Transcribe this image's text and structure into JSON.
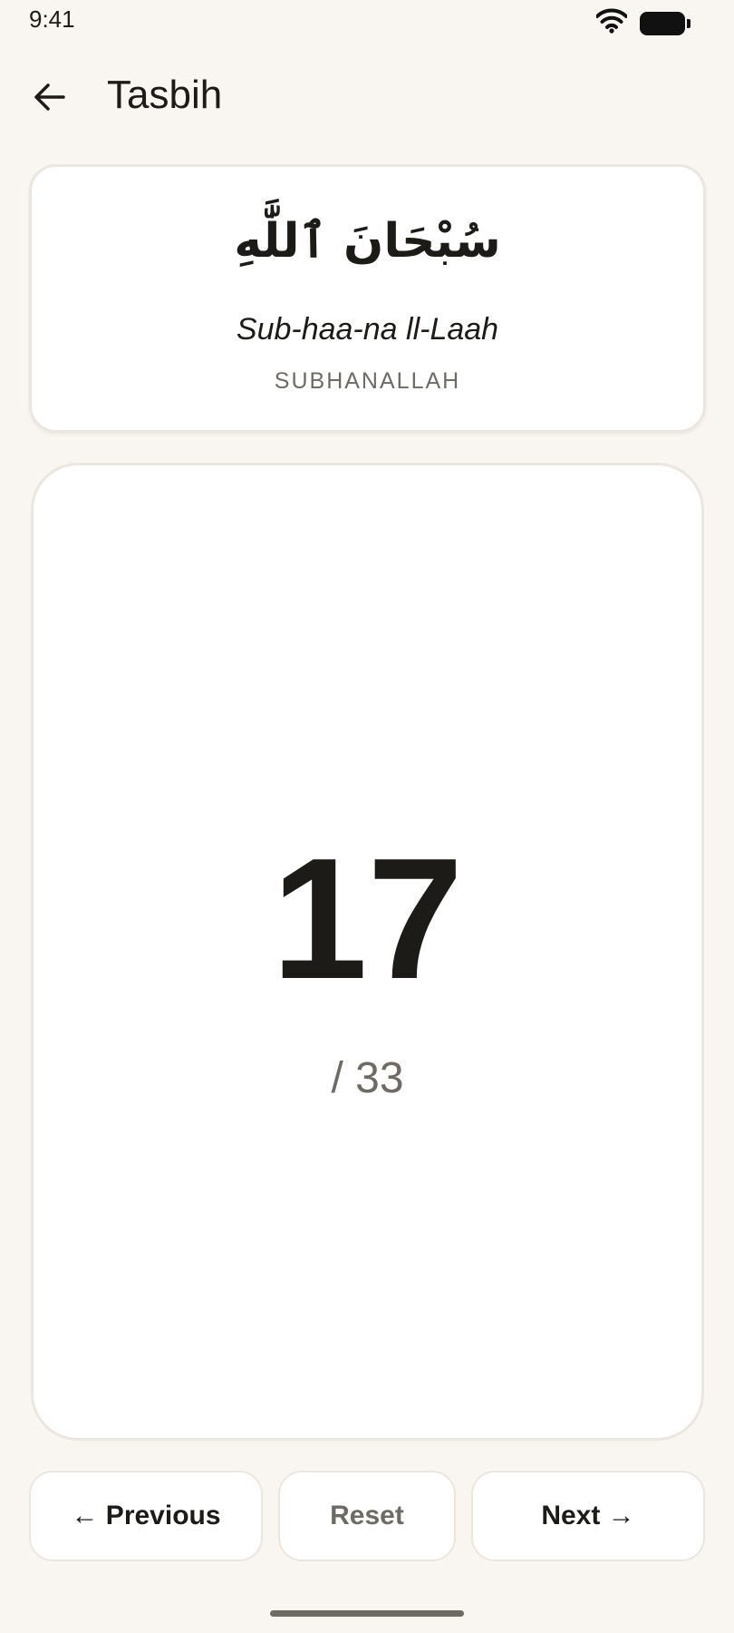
{
  "status_bar": {
    "time": "9:41",
    "icons": [
      "wifi-icon",
      "battery-icon"
    ]
  },
  "app_bar": {
    "back_icon": "arrow-left-icon",
    "title": "Tasbih"
  },
  "dhikr": {
    "arabic": "سُبْحَانَ ٱللَّٰهِ",
    "transliteration": "Sub-haa-na ll-Laah",
    "name": "SUBHANALLAH"
  },
  "counter": {
    "count": "17",
    "target": "/ 33"
  },
  "actions": {
    "previous_label": "← Previous",
    "reset_label": "Reset",
    "next_label": "Next →"
  },
  "colors": {
    "background": "#f9f6f1",
    "card": "#ffffff",
    "border": "#ebe6de",
    "text_primary": "#1c1b18",
    "text_secondary": "#6e6a64"
  }
}
